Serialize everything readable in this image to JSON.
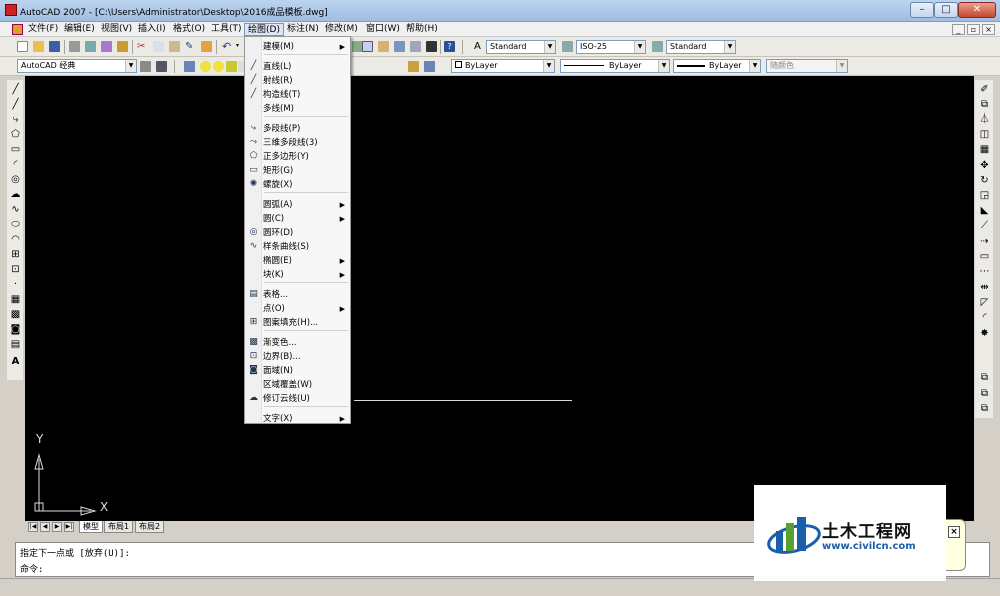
{
  "window": {
    "title": "AutoCAD 2007 - [C:\\Users\\Administrator\\Desktop\\2016成品模板.dwg]",
    "minimize": "–",
    "maximize": "□",
    "close": "✕"
  },
  "menubar": {
    "items": [
      "文件(F)",
      "编辑(E)",
      "视图(V)",
      "插入(I)",
      "格式(O)",
      "工具(T)",
      "绘图(D)",
      "标注(N)",
      "修改(M)",
      "窗口(W)",
      "帮助(H)"
    ],
    "active": "绘图(D)",
    "mdi": [
      "_",
      "▫",
      "×"
    ]
  },
  "toolbar1": {
    "text_style": "Standard",
    "dim_style": "ISO-25",
    "table_style": "Standard"
  },
  "toolbar2": {
    "workspace": "AutoCAD 经典",
    "layer_color": "ByLayer",
    "linetype": "ByLayer",
    "lineweight": "ByLayer",
    "plot_style": "随颜色"
  },
  "draw_menu": {
    "items": [
      {
        "label": "建模(M)",
        "icon": "",
        "submenu": true
      },
      {
        "label": "直线(L)",
        "icon": "line-icon",
        "submenu": false
      },
      {
        "label": "射线(R)",
        "icon": "ray-icon",
        "submenu": false
      },
      {
        "label": "构造线(T)",
        "icon": "xline-icon",
        "submenu": false
      },
      {
        "label": "多线(M)",
        "icon": "",
        "submenu": false
      },
      {
        "label": "多段线(P)",
        "icon": "polyline-icon",
        "submenu": false
      },
      {
        "label": "三维多段线(3)",
        "icon": "3dpoly-icon",
        "submenu": false
      },
      {
        "label": "正多边形(Y)",
        "icon": "polygon-icon",
        "submenu": false
      },
      {
        "label": "矩形(G)",
        "icon": "rectangle-icon",
        "submenu": false
      },
      {
        "label": "螺旋(X)",
        "icon": "helix-icon",
        "submenu": false
      },
      {
        "label": "圆弧(A)",
        "icon": "",
        "submenu": true
      },
      {
        "label": "圆(C)",
        "icon": "",
        "submenu": true
      },
      {
        "label": "圆环(D)",
        "icon": "donut-icon",
        "submenu": false
      },
      {
        "label": "样条曲线(S)",
        "icon": "spline-icon",
        "submenu": false
      },
      {
        "label": "椭圆(E)",
        "icon": "",
        "submenu": true
      },
      {
        "label": "块(K)",
        "icon": "",
        "submenu": true
      },
      {
        "label": "表格...",
        "icon": "table-icon",
        "submenu": false
      },
      {
        "label": "点(O)",
        "icon": "",
        "submenu": true
      },
      {
        "label": "图案填充(H)...",
        "icon": "hatch-icon",
        "submenu": false
      },
      {
        "label": "渐变色...",
        "icon": "gradient-icon",
        "submenu": false
      },
      {
        "label": "边界(B)...",
        "icon": "boundary-icon",
        "submenu": false
      },
      {
        "label": "面域(N)",
        "icon": "region-icon",
        "submenu": false
      },
      {
        "label": "区域覆盖(W)",
        "icon": "",
        "submenu": false
      },
      {
        "label": "修订云线(U)",
        "icon": "revcloud-icon",
        "submenu": false
      },
      {
        "label": "文字(X)",
        "icon": "",
        "submenu": true
      }
    ]
  },
  "ucs": {
    "x": "X",
    "y": "Y"
  },
  "tabs": {
    "items": [
      "模型",
      "布局1",
      "布局2"
    ],
    "active": "模型"
  },
  "command": {
    "line1": "指定下一点或 [放弃(U)]:",
    "line2": "命令:"
  },
  "watermark": {
    "name": "土木工程网",
    "url": "www.civilcn.com",
    "close": "×"
  }
}
